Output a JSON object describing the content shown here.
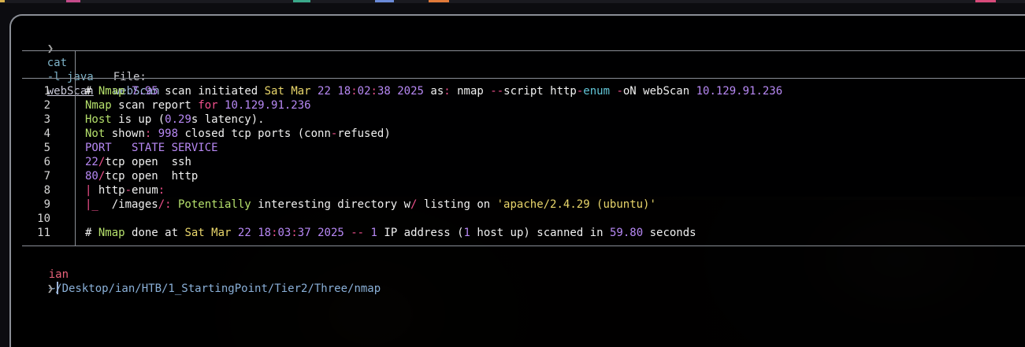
{
  "command": {
    "prompt": "❯",
    "name": "cat",
    "flags": "-l java",
    "file": "webScan"
  },
  "file_header": {
    "label": "File:",
    "filename": "webScan"
  },
  "content": {
    "line_numbers": [
      "1",
      "2",
      "3",
      "4",
      "5",
      "6",
      "7",
      "8",
      "9",
      "10",
      "11"
    ],
    "lines": [
      [
        [
          "#",
          "white"
        ],
        [
          " Nmap",
          "green"
        ],
        [
          " 7.95",
          "purple"
        ],
        [
          " scan initiated ",
          "white"
        ],
        [
          "Sat Mar",
          "yellow"
        ],
        [
          " 22",
          "purple"
        ],
        [
          " 18",
          "purple"
        ],
        [
          ":",
          "pink"
        ],
        [
          "02",
          "purple"
        ],
        [
          ":",
          "pink"
        ],
        [
          "38",
          "purple"
        ],
        [
          " 2025",
          "purple"
        ],
        [
          " as",
          "white"
        ],
        [
          ":",
          "pink"
        ],
        [
          " nmap ",
          "white"
        ],
        [
          "--",
          "pink"
        ],
        [
          "script http",
          "white"
        ],
        [
          "-",
          "pink"
        ],
        [
          "enum",
          "cyan"
        ],
        [
          " -",
          "pink"
        ],
        [
          "oN webScan ",
          "white"
        ],
        [
          "10.129.91.236",
          "purple"
        ]
      ],
      [
        [
          "Nmap",
          "green"
        ],
        [
          " scan report ",
          "white"
        ],
        [
          "for",
          "pink"
        ],
        [
          " 10.129.91.236",
          "purple"
        ]
      ],
      [
        [
          "Host",
          "green"
        ],
        [
          " is up (",
          "white"
        ],
        [
          "0.29",
          "purple"
        ],
        [
          "s latency).",
          "white"
        ]
      ],
      [
        [
          "Not",
          "green"
        ],
        [
          " shown",
          "white"
        ],
        [
          ":",
          "pink"
        ],
        [
          " 998",
          "purple"
        ],
        [
          " closed tcp ports (conn",
          "white"
        ],
        [
          "-",
          "pink"
        ],
        [
          "refused)",
          "white"
        ]
      ],
      [
        [
          "PORT   STATE SERVICE",
          "purple"
        ]
      ],
      [
        [
          "22",
          "purple"
        ],
        [
          "/",
          "pink"
        ],
        [
          "tcp open  ssh",
          "white"
        ]
      ],
      [
        [
          "80",
          "purple"
        ],
        [
          "/",
          "pink"
        ],
        [
          "tcp open  http",
          "white"
        ]
      ],
      [
        [
          "|",
          "pink"
        ],
        [
          " http",
          "white"
        ],
        [
          "-",
          "pink"
        ],
        [
          "enum",
          "white"
        ],
        [
          ":",
          "pink"
        ]
      ],
      [
        [
          "|_",
          "pink"
        ],
        [
          "  /images",
          "white"
        ],
        [
          "/:",
          "pink"
        ],
        [
          " Potentially",
          "green"
        ],
        [
          " interesting directory w",
          "white"
        ],
        [
          "/",
          "pink"
        ],
        [
          " listing on ",
          "white"
        ],
        [
          "'apache/2.4.29 (ubuntu)'",
          "yellow"
        ]
      ],
      [],
      [
        [
          "#",
          "white"
        ],
        [
          " Nmap",
          "green"
        ],
        [
          " done at ",
          "white"
        ],
        [
          "Sat Mar",
          "yellow"
        ],
        [
          " 22",
          "purple"
        ],
        [
          " 18",
          "purple"
        ],
        [
          ":",
          "pink"
        ],
        [
          "03",
          "purple"
        ],
        [
          ":",
          "pink"
        ],
        [
          "37",
          "purple"
        ],
        [
          " 2025",
          "purple"
        ],
        [
          " --",
          "pink"
        ],
        [
          " 1",
          "purple"
        ],
        [
          " IP address (",
          "white"
        ],
        [
          "1",
          "purple"
        ],
        [
          " host up) scanned in ",
          "white"
        ],
        [
          "59.80",
          "purple"
        ],
        [
          " seconds",
          "white"
        ]
      ]
    ]
  },
  "status": {
    "user": "ian",
    "cwd": "~/Desktop/ian/HTB/1_StartingPoint/Tier2/Three/nmap",
    "prompt": "❯"
  },
  "colors": {
    "white": "#f0f0f0",
    "green": "#b5e06c",
    "purple": "#b788f4",
    "yellow": "#e9d66b",
    "pink": "#f0508c",
    "cyan": "#62c6d8"
  }
}
